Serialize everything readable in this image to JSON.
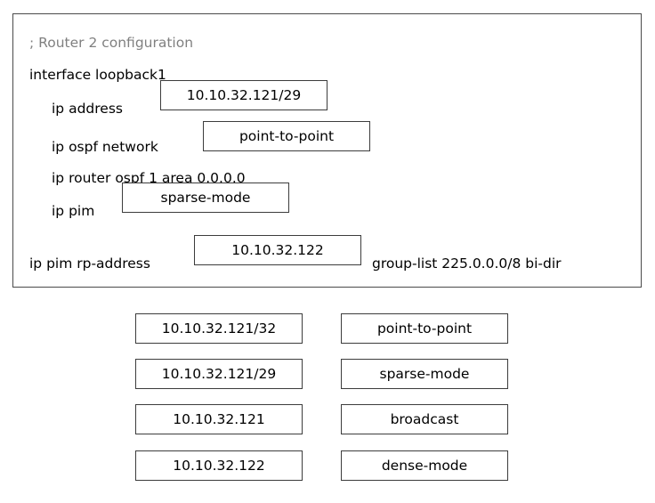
{
  "config_panel": {
    "lines": [
      {
        "id": "comment",
        "text": "; Router 2 configuration"
      },
      {
        "id": "interface",
        "text": "interface loopback1"
      },
      {
        "id": "ip-address",
        "text": "ip address"
      },
      {
        "id": "ospf-network",
        "text": "ip ospf network"
      },
      {
        "id": "router-ospf",
        "text": "ip router ospf 1 area 0.0.0.0"
      },
      {
        "id": "ip-pim",
        "text": "ip pim"
      },
      {
        "id": "rp-address",
        "text": "ip pim rp-address"
      },
      {
        "id": "group-list",
        "text": "group-list 225.0.0.0/8 bi-dir"
      }
    ],
    "dropzones": [
      {
        "id": "ip-address-value",
        "value": "10.10.32.121/29"
      },
      {
        "id": "ospf-network-value",
        "value": "point-to-point"
      },
      {
        "id": "ip-pim-value",
        "value": "sparse-mode"
      },
      {
        "id": "rp-address-value",
        "value": "10.10.32.122"
      }
    ]
  },
  "options": {
    "left_column": [
      {
        "label": "10.10.32.121/32"
      },
      {
        "label": "10.10.32.121/29"
      },
      {
        "label": "10.10.32.121"
      },
      {
        "label": "10.10.32.122"
      }
    ],
    "right_column": [
      {
        "label": "point-to-point"
      },
      {
        "label": "sparse-mode"
      },
      {
        "label": "broadcast"
      },
      {
        "label": "dense-mode"
      }
    ]
  },
  "colors": {
    "border": "#3c3c3c",
    "panel_border": "#4a4a4a",
    "comment_text": "#808080",
    "body_text": "#000000",
    "background": "#ffffff"
  }
}
